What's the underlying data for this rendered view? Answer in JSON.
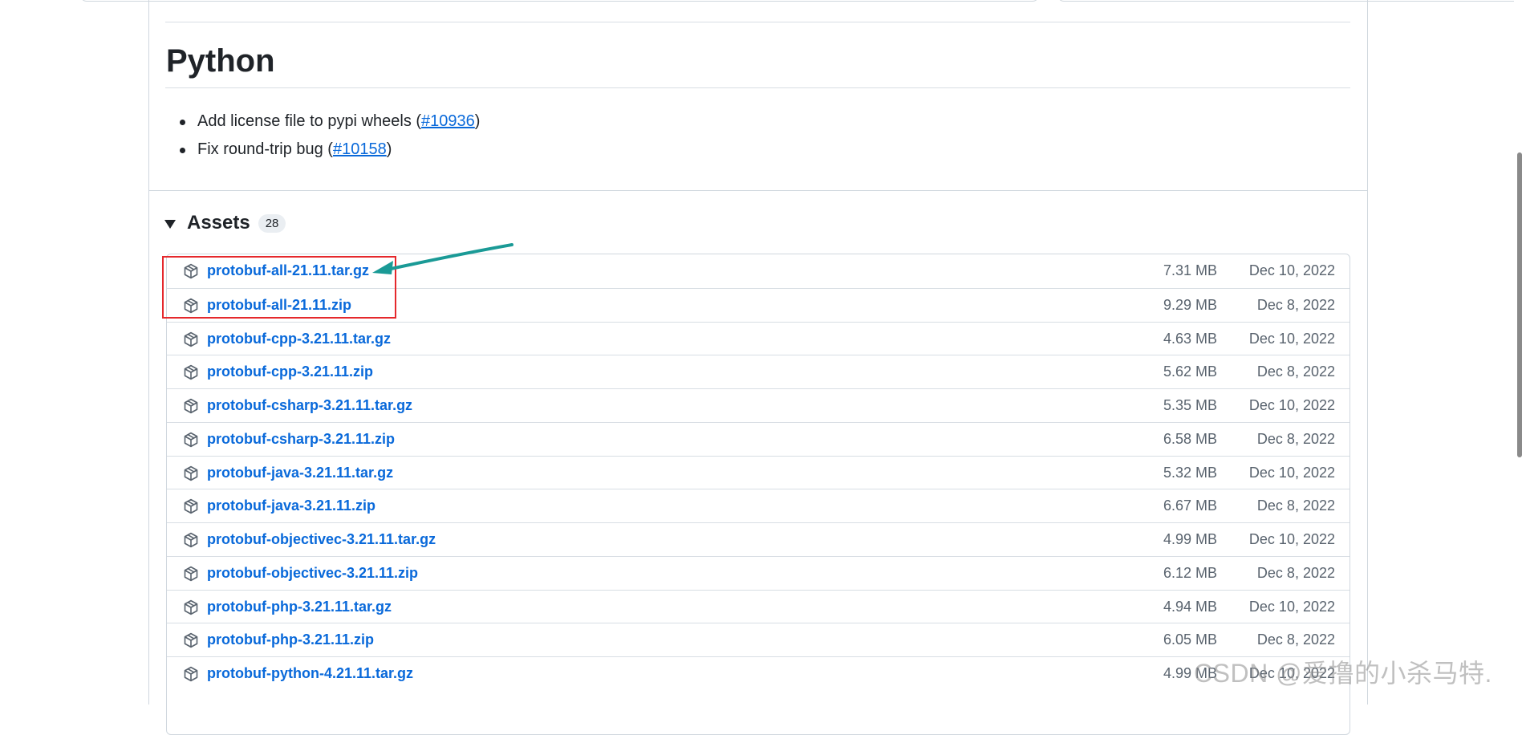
{
  "section": {
    "title": "Python",
    "notes": [
      {
        "before": "Add license file to pypi wheels (",
        "link": "#10936",
        "after": ")"
      },
      {
        "before": "Fix round-trip bug (",
        "link": "#10158",
        "after": ")"
      }
    ]
  },
  "assets": {
    "title": "Assets",
    "count": "28",
    "items": [
      {
        "name": "protobuf-all-21.11.tar.gz",
        "size": "7.31 MB",
        "date": "Dec 10, 2022"
      },
      {
        "name": "protobuf-all-21.11.zip",
        "size": "9.29 MB",
        "date": "Dec 8, 2022"
      },
      {
        "name": "protobuf-cpp-3.21.11.tar.gz",
        "size": "4.63 MB",
        "date": "Dec 10, 2022"
      },
      {
        "name": "protobuf-cpp-3.21.11.zip",
        "size": "5.62 MB",
        "date": "Dec 8, 2022"
      },
      {
        "name": "protobuf-csharp-3.21.11.tar.gz",
        "size": "5.35 MB",
        "date": "Dec 10, 2022"
      },
      {
        "name": "protobuf-csharp-3.21.11.zip",
        "size": "6.58 MB",
        "date": "Dec 8, 2022"
      },
      {
        "name": "protobuf-java-3.21.11.tar.gz",
        "size": "5.32 MB",
        "date": "Dec 10, 2022"
      },
      {
        "name": "protobuf-java-3.21.11.zip",
        "size": "6.67 MB",
        "date": "Dec 8, 2022"
      },
      {
        "name": "protobuf-objectivec-3.21.11.tar.gz",
        "size": "4.99 MB",
        "date": "Dec 10, 2022"
      },
      {
        "name": "protobuf-objectivec-3.21.11.zip",
        "size": "6.12 MB",
        "date": "Dec 8, 2022"
      },
      {
        "name": "protobuf-php-3.21.11.tar.gz",
        "size": "4.94 MB",
        "date": "Dec 10, 2022"
      },
      {
        "name": "protobuf-php-3.21.11.zip",
        "size": "6.05 MB",
        "date": "Dec 8, 2022"
      },
      {
        "name": "protobuf-python-4.21.11.tar.gz",
        "size": "4.99 MB",
        "date": "Dec 10, 2022"
      }
    ]
  },
  "annotation": {
    "highlight_color": "#e5282c",
    "arrow_color": "#1a9a96"
  },
  "watermark": "CSDN @爱撸的小杀马特."
}
